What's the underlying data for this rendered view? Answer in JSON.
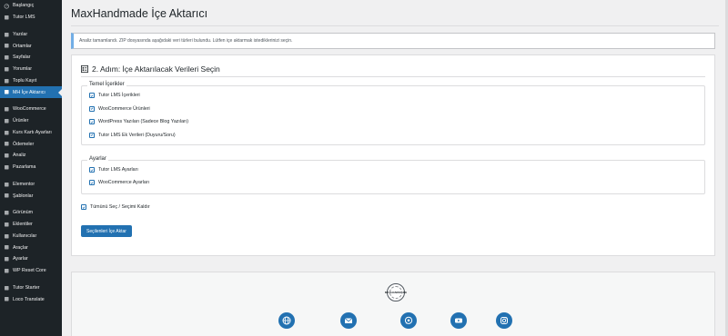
{
  "sidebar": {
    "items": [
      {
        "label": "Başlangıç",
        "icon": "dashboard-icon"
      },
      {
        "label": "Tutor LMS",
        "icon": "tutor-icon"
      },
      {
        "sep": true
      },
      {
        "label": "Yazılar",
        "icon": "pin-icon"
      },
      {
        "label": "Ortamlar",
        "icon": "media-icon"
      },
      {
        "label": "Sayfalar",
        "icon": "page-icon"
      },
      {
        "label": "Yorumlar",
        "icon": "comment-icon"
      },
      {
        "label": "Toplu Kayıt",
        "icon": "users-icon"
      },
      {
        "label": "MH İçe Aktarıcı",
        "icon": "import-icon",
        "active": true
      },
      {
        "sep": true
      },
      {
        "label": "WooCommerce",
        "icon": "woo-icon"
      },
      {
        "label": "Ürünler",
        "icon": "box-icon"
      },
      {
        "label": "Kurs Kartı Ayarları",
        "icon": "card-icon"
      },
      {
        "label": "Ödemeler",
        "icon": "dollar-icon"
      },
      {
        "label": "Analiz",
        "icon": "chart-icon"
      },
      {
        "label": "Pazarlama",
        "icon": "megaphone-icon"
      },
      {
        "sep": true
      },
      {
        "label": "Elementor",
        "icon": "elementor-icon"
      },
      {
        "label": "Şablonlar",
        "icon": "folder-icon"
      },
      {
        "sep": true
      },
      {
        "label": "Görünüm",
        "icon": "brush-icon"
      },
      {
        "label": "Eklentiler",
        "icon": "plugin-icon"
      },
      {
        "label": "Kullanıcılar",
        "icon": "user-icon"
      },
      {
        "label": "Araçlar",
        "icon": "wrench-icon"
      },
      {
        "label": "Ayarlar",
        "icon": "settings-icon"
      },
      {
        "label": "WP Reset Core",
        "icon": "reset-icon"
      },
      {
        "sep": true
      },
      {
        "label": "Tutor Starter",
        "icon": "tutor-starter-icon"
      },
      {
        "label": "Loco Translate",
        "icon": "translate-icon"
      }
    ]
  },
  "page": {
    "title": "MaxHandmade İçe Aktarıcı",
    "notice": "Analiz tamamlandı. ZIP dosyasında aşağıdaki veri türleri bulundu. Lütfen içe aktarmak istediklerinizi seçin."
  },
  "step": {
    "title": "2. Adım: İçe Aktarılacak Verileri Seçin",
    "basic": {
      "legend": "Temel İçerikler",
      "items": [
        {
          "label": "Tutor LMS İçerikleri",
          "checked": true
        },
        {
          "label": "WooCommerce Ürünleri",
          "checked": true
        },
        {
          "label": "WordPress Yazıları (Sadece Blog Yazıları)",
          "checked": true
        },
        {
          "label": "Tutor LMS Ek Verileri (Duyuru/Soru)",
          "checked": true
        }
      ]
    },
    "settings": {
      "legend": "Ayarlar",
      "items": [
        {
          "label": "Tutor LMS Ayarları",
          "checked": true
        },
        {
          "label": "WooCommerce Ayarları",
          "checked": true
        }
      ]
    },
    "toggle_all": "Tümünü Seç / Seçimi Kaldır",
    "import_button": "Seçilenleri İçe Aktar"
  },
  "footer": {
    "logo_text": "MAXHANDMADE",
    "social": [
      "globe-icon",
      "email-icon",
      "whatsapp-icon",
      "youtube-icon",
      "instagram-icon"
    ]
  },
  "colors": {
    "sidebar_bg": "#1d2327",
    "accent": "#2271b1",
    "page_bg": "#f0f0f1"
  }
}
